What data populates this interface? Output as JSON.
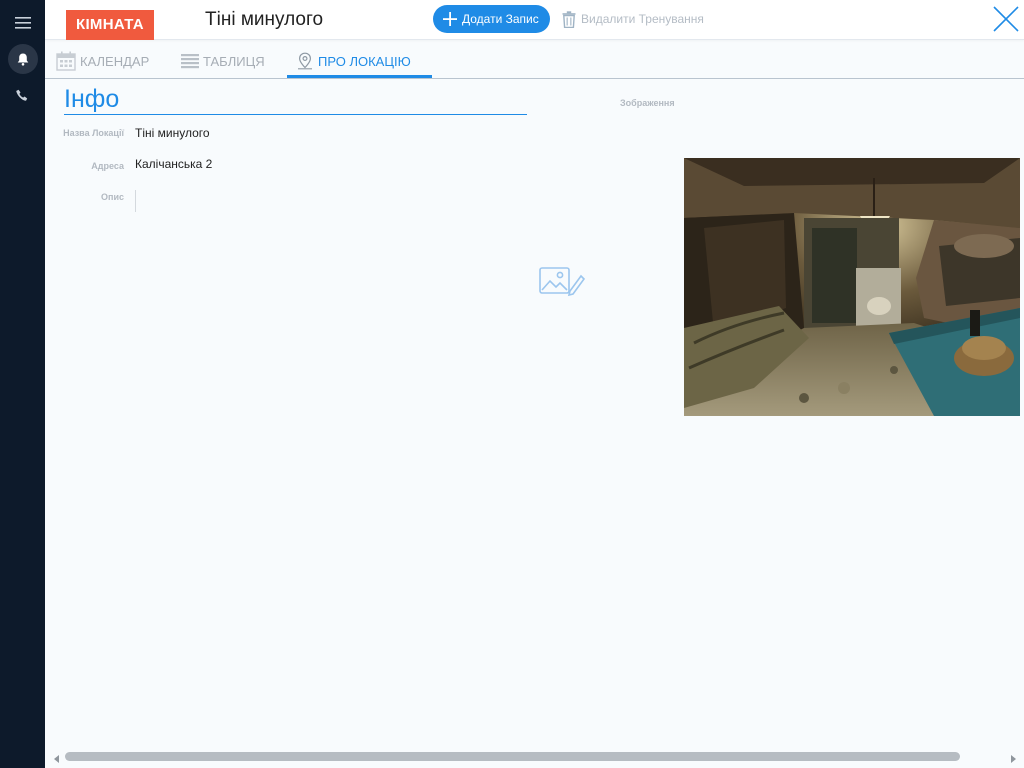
{
  "sidebar": {
    "icons": [
      "menu-icon",
      "bell-icon",
      "phone-icon"
    ]
  },
  "header": {
    "badge": "КІМНАТА",
    "title": "Тіні минулого",
    "add_button": "Додати Запис",
    "delete_button": "Видалити Тренування"
  },
  "tabs": [
    {
      "label": "КАЛЕНДАР",
      "icon": "calendar-icon",
      "active": false
    },
    {
      "label": "ТАБЛИЦЯ",
      "icon": "table-icon",
      "active": false
    },
    {
      "label": "ПРО ЛОКАЦІЮ",
      "icon": "location-pin-icon",
      "active": true
    }
  ],
  "info": {
    "heading": "Інфо",
    "fields": [
      {
        "label": "Назва Локації",
        "value": "Тіні минулого"
      },
      {
        "label": "Адреса",
        "value": "Калічанська 2"
      },
      {
        "label": "Опис",
        "value": ""
      }
    ],
    "image_label": "Зображення"
  },
  "colors": {
    "accent": "#1f8be6",
    "badge": "#f05a3e",
    "sidebar": "#0d1a2b"
  }
}
